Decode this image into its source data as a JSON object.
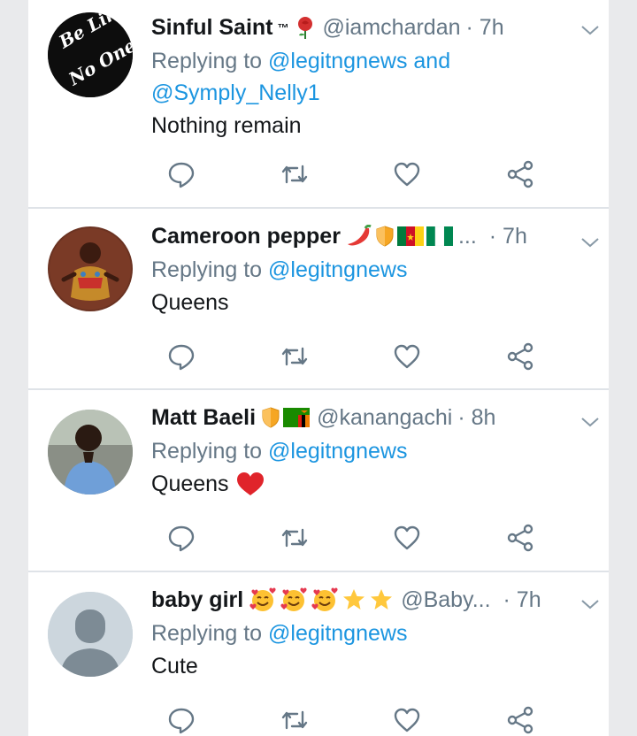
{
  "tweets": [
    {
      "name": "Sinful Saint",
      "tm": "™",
      "handle": "@iamchardan",
      "time": "· 7h",
      "reply_prefix": "Replying to",
      "mentions": "@legitngnews and @Symply_Nelly1",
      "text": "Nothing remain",
      "avatar_text": "Be Like No One!"
    },
    {
      "name": "Cameroon pepper",
      "handle": "...",
      "time": "· 7h",
      "reply_prefix": "Replying to",
      "mentions": "@legitngnews",
      "text": "Queens"
    },
    {
      "name": "Matt Baeli",
      "handle": "@kanangachi",
      "time": "· 8h",
      "reply_prefix": "Replying to",
      "mentions": "@legitngnews",
      "text": "Queens"
    },
    {
      "name": "baby girl",
      "handle": "@Baby...",
      "time": "· 7h",
      "reply_prefix": "Replying to",
      "mentions": "@legitngnews",
      "text": "Cute"
    }
  ],
  "icons": {
    "reply": "reply-icon",
    "retweet": "retweet-icon",
    "like": "heart-icon",
    "share": "share-icon",
    "caret": "chevron-down-icon"
  },
  "colors": {
    "name": "#14171a",
    "muted": "#657786",
    "link": "#1b95e0",
    "divider": "#dfe3e8"
  }
}
